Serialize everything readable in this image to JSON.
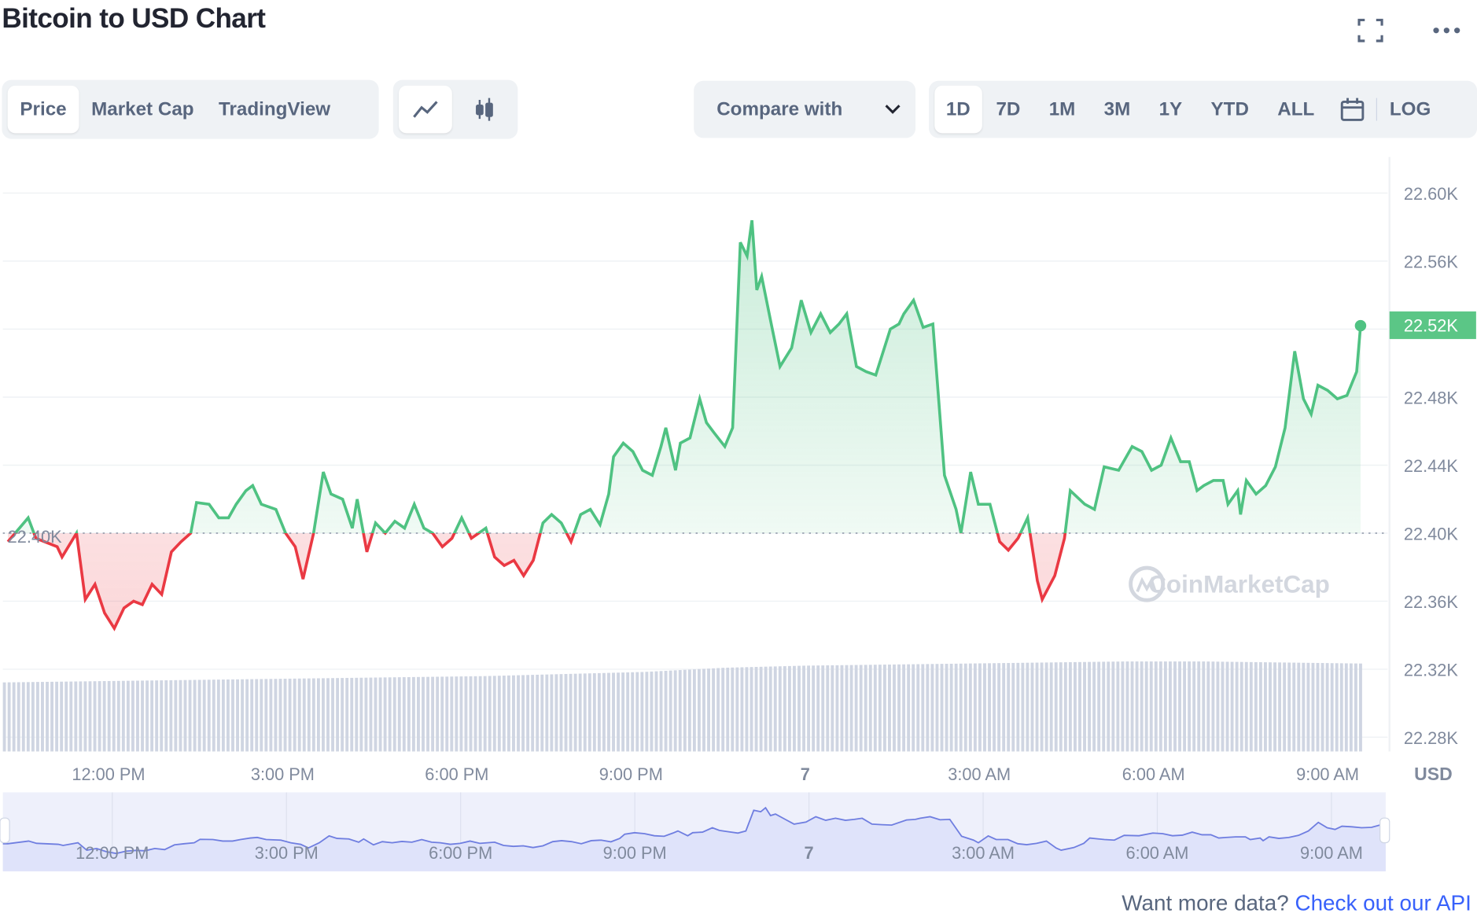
{
  "header": {
    "title": "Bitcoin to USD Chart",
    "fullscreen_icon": "fullscreen-icon",
    "more_icon": "more-dots-icon"
  },
  "tabs": [
    {
      "label": "Price",
      "active": true
    },
    {
      "label": "Market Cap"
    },
    {
      "label": "TradingView"
    }
  ],
  "chart_type_buttons": [
    {
      "icon": "line-chart-icon",
      "active": true
    },
    {
      "icon": "candlestick-icon"
    }
  ],
  "compare": {
    "label": "Compare with",
    "icon": "chevron-down-icon"
  },
  "ranges": [
    {
      "label": "1D",
      "active": true
    },
    {
      "label": "7D"
    },
    {
      "label": "1M"
    },
    {
      "label": "3M"
    },
    {
      "label": "1Y"
    },
    {
      "label": "YTD"
    },
    {
      "label": "ALL"
    }
  ],
  "calendar_icon": "calendar-icon",
  "log_label": "LOG",
  "footer": {
    "text": "Want more data?",
    "link": "Check out our API"
  },
  "watermark": "CoinMarketCap",
  "colors": {
    "up": "#4fc282",
    "down": "#ea3943",
    "label_bg": "#5bc686",
    "volume": "#cfd5e2",
    "navigator_fill": "#dfe3fa",
    "navigator_line": "#6f7ee0"
  },
  "chart_data": {
    "type": "line",
    "title": "Bitcoin to USD Chart",
    "ylabel": "USD",
    "ylim": [
      22280,
      22620
    ],
    "y_ticks": [
      "22.60K",
      "22.56K",
      "22.52K",
      "22.48K",
      "22.44K",
      "22.40K",
      "22.36K",
      "22.32K",
      "22.28K"
    ],
    "y_tick_values": [
      22600,
      22560,
      22520,
      22480,
      22440,
      22400,
      22360,
      22320,
      22280
    ],
    "x_ticks": [
      "12:00 PM",
      "3:00 PM",
      "6:00 PM",
      "9:00 PM",
      "7",
      "3:00 AM",
      "6:00 AM",
      "9:00 AM"
    ],
    "x_tick_times": [
      "12:00",
      "15:00",
      "18:00",
      "21:00",
      "00:00",
      "03:00",
      "06:00",
      "09:00"
    ],
    "baseline": 22400,
    "baseline_label": "22.40K",
    "current_price_label": "22.52K",
    "grid": true,
    "series": [
      {
        "points": [
          [
            "10:16",
            22395
          ],
          [
            "10:37",
            22409
          ],
          [
            "10:45",
            22397
          ],
          [
            "11:07",
            22392
          ],
          [
            "11:12",
            22386
          ],
          [
            "11:27",
            22400
          ],
          [
            "11:36",
            22361
          ],
          [
            "11:46",
            22370
          ],
          [
            "11:56",
            22353
          ],
          [
            "12:06",
            22344
          ],
          [
            "12:16",
            22356
          ],
          [
            "12:26",
            22360
          ],
          [
            "12:35",
            22358
          ],
          [
            "12:45",
            22370
          ],
          [
            "12:55",
            22364
          ],
          [
            "13:05",
            22389
          ],
          [
            "13:15",
            22395
          ],
          [
            "13:25",
            22400
          ],
          [
            "13:31",
            22418
          ],
          [
            "13:44",
            22417
          ],
          [
            "13:54",
            22409
          ],
          [
            "14:04",
            22409
          ],
          [
            "14:12",
            22417
          ],
          [
            "14:22",
            22425
          ],
          [
            "14:29",
            22428
          ],
          [
            "14:38",
            22417
          ],
          [
            "14:53",
            22414
          ],
          [
            "15:03",
            22400
          ],
          [
            "15:13",
            22392
          ],
          [
            "15:21",
            22373
          ],
          [
            "15:32",
            22400
          ],
          [
            "15:42",
            22436
          ],
          [
            "15:50",
            22423
          ],
          [
            "16:02",
            22420
          ],
          [
            "16:12",
            22403
          ],
          [
            "16:17",
            22420
          ],
          [
            "16:27",
            22389
          ],
          [
            "16:36",
            22406
          ],
          [
            "16:46",
            22400
          ],
          [
            "16:56",
            22407
          ],
          [
            "17:06",
            22403
          ],
          [
            "17:16",
            22417
          ],
          [
            "17:26",
            22403
          ],
          [
            "17:35",
            22400
          ],
          [
            "17:45",
            22392
          ],
          [
            "17:55",
            22397
          ],
          [
            "18:05",
            22409
          ],
          [
            "18:15",
            22397
          ],
          [
            "18:30",
            22403
          ],
          [
            "18:39",
            22386
          ],
          [
            "18:49",
            22381
          ],
          [
            "18:59",
            22384
          ],
          [
            "19:09",
            22375
          ],
          [
            "19:19",
            22384
          ],
          [
            "19:29",
            22406
          ],
          [
            "19:38",
            22411
          ],
          [
            "19:48",
            22406
          ],
          [
            "19:58",
            22395
          ],
          [
            "20:08",
            22411
          ],
          [
            "20:18",
            22414
          ],
          [
            "20:28",
            22405
          ],
          [
            "20:37",
            22423
          ],
          [
            "20:42",
            22445
          ],
          [
            "20:52",
            22453
          ],
          [
            "21:02",
            22448
          ],
          [
            "21:12",
            22437
          ],
          [
            "21:22",
            22434
          ],
          [
            "21:31",
            22451
          ],
          [
            "21:36",
            22462
          ],
          [
            "21:46",
            22437
          ],
          [
            "21:51",
            22453
          ],
          [
            "22:01",
            22456
          ],
          [
            "22:11",
            22479
          ],
          [
            "22:18",
            22465
          ],
          [
            "22:26",
            22459
          ],
          [
            "22:37",
            22451
          ],
          [
            "22:45",
            22462
          ],
          [
            "22:53",
            22571
          ],
          [
            "23:00",
            22563
          ],
          [
            "23:05",
            22584
          ],
          [
            "23:10",
            22543
          ],
          [
            "23:15",
            22551
          ],
          [
            "23:25",
            22523
          ],
          [
            "23:34",
            22498
          ],
          [
            "23:46",
            22509
          ],
          [
            "23:56",
            22537
          ],
          [
            "00:06",
            22518
          ],
          [
            "00:16",
            22529
          ],
          [
            "00:26",
            22518
          ],
          [
            "00:35",
            22523
          ],
          [
            "00:43",
            22529
          ],
          [
            "00:53",
            22498
          ],
          [
            "01:03",
            22495
          ],
          [
            "01:13",
            22493
          ],
          [
            "01:28",
            22520
          ],
          [
            "01:37",
            22523
          ],
          [
            "01:42",
            22529
          ],
          [
            "01:52",
            22537
          ],
          [
            "02:02",
            22521
          ],
          [
            "02:12",
            22523
          ],
          [
            "02:24",
            22434
          ],
          [
            "02:36",
            22414
          ],
          [
            "02:41",
            22400
          ],
          [
            "02:51",
            22436
          ],
          [
            "02:59",
            22417
          ],
          [
            "03:11",
            22417
          ],
          [
            "03:21",
            22395
          ],
          [
            "03:30",
            22390
          ],
          [
            "03:40",
            22397
          ],
          [
            "03:50",
            22409
          ],
          [
            "04:00",
            22372
          ],
          [
            "04:05",
            22361
          ],
          [
            "04:18",
            22375
          ],
          [
            "04:28",
            22397
          ],
          [
            "04:34",
            22425
          ],
          [
            "04:49",
            22417
          ],
          [
            "04:59",
            22414
          ],
          [
            "05:09",
            22439
          ],
          [
            "05:24",
            22437
          ],
          [
            "05:38",
            22451
          ],
          [
            "05:48",
            22448
          ],
          [
            "05:58",
            22437
          ],
          [
            "06:08",
            22440
          ],
          [
            "06:18",
            22456
          ],
          [
            "06:28",
            22442
          ],
          [
            "06:37",
            22442
          ],
          [
            "06:45",
            22425
          ],
          [
            "06:52",
            22428
          ],
          [
            "07:02",
            22431
          ],
          [
            "07:12",
            22431
          ],
          [
            "07:17",
            22417
          ],
          [
            "07:27",
            22425
          ],
          [
            "07:30",
            22411
          ],
          [
            "07:36",
            22431
          ],
          [
            "07:46",
            22423
          ],
          [
            "07:56",
            22428
          ],
          [
            "08:06",
            22439
          ],
          [
            "08:16",
            22462
          ],
          [
            "08:26",
            22507
          ],
          [
            "08:35",
            22479
          ],
          [
            "08:43",
            22470
          ],
          [
            "08:50",
            22487
          ],
          [
            "09:00",
            22484
          ],
          [
            "09:10",
            22479
          ],
          [
            "09:20",
            22481
          ],
          [
            "09:30",
            22495
          ],
          [
            "09:34",
            22522
          ]
        ]
      }
    ],
    "volume_relative": [
      0.66,
      0.67,
      0.68,
      0.69,
      0.7,
      0.71,
      0.72,
      0.74,
      0.76,
      0.8,
      0.82,
      0.83,
      0.84,
      0.85,
      0.86,
      0.86,
      0.85,
      0.84
    ]
  }
}
